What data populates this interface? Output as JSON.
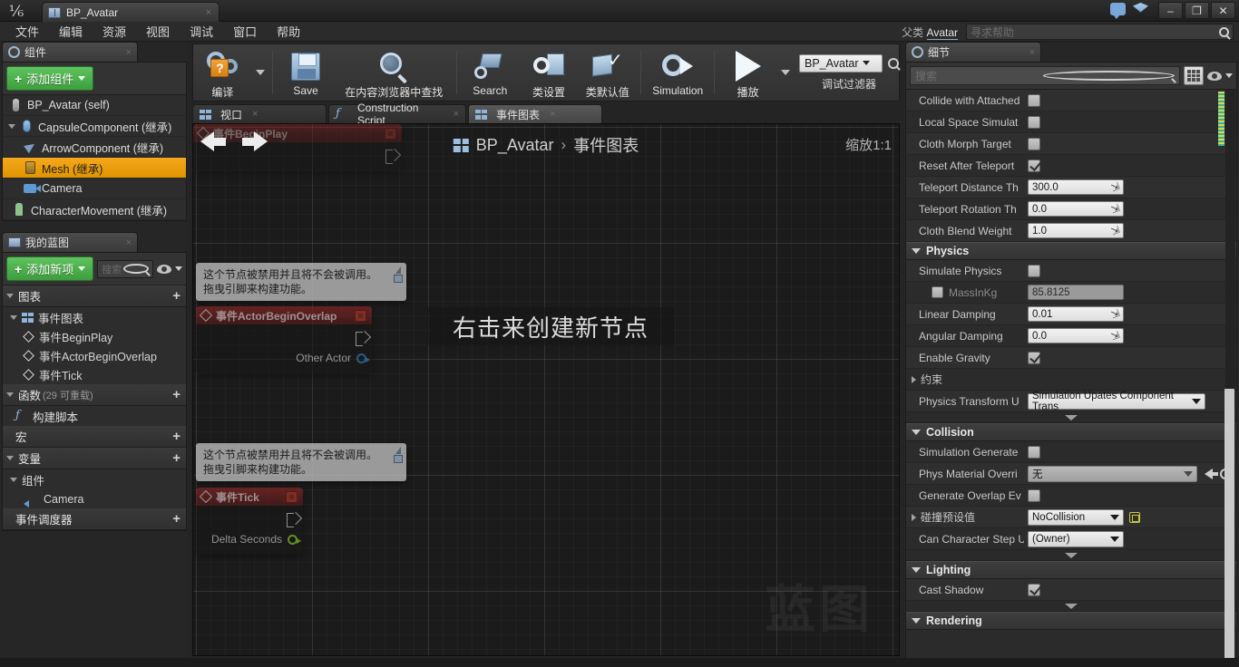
{
  "window": {
    "tab_title": "BP_Avatar",
    "tab_close": "×",
    "minimize": "–",
    "maximize": "❐",
    "close": "✕"
  },
  "menubar": {
    "items": [
      "文件",
      "编辑",
      "资源",
      "视图",
      "调试",
      "窗口",
      "帮助"
    ],
    "parent_class_label": "父类",
    "parent_class_value": "Avatar",
    "help_placeholder": "寻求帮助"
  },
  "toolbar": {
    "items": [
      {
        "label": "编译",
        "icon": "compile-icon"
      },
      {
        "label": "Save",
        "icon": "save-icon"
      },
      {
        "label": "在内容浏览器中查找",
        "icon": "find-in-content-browser-icon"
      },
      {
        "label": "Search",
        "icon": "search-icon"
      },
      {
        "label": "类设置",
        "icon": "class-settings-icon"
      },
      {
        "label": "类默认值",
        "icon": "class-defaults-icon"
      },
      {
        "label": "Simulation",
        "icon": "simulation-icon"
      },
      {
        "label": "播放",
        "icon": "play-icon"
      }
    ],
    "debug_filter_value": "BP_Avatar",
    "debug_filter_label": "调试过滤器"
  },
  "components_panel": {
    "tab_label": "组件",
    "tab_close": "×",
    "add_button": "添加组件",
    "items": [
      {
        "label": "BP_Avatar (self)",
        "indent": 0,
        "icon": "actor-icon",
        "selected": false,
        "twirl": ""
      },
      {
        "label": "CapsuleComponent (继承)",
        "indent": 0,
        "icon": "capsule-icon",
        "selected": false,
        "twirl": "open"
      },
      {
        "label": "ArrowComponent (继承)",
        "indent": 1,
        "icon": "arrow-icon",
        "selected": false,
        "twirl": ""
      },
      {
        "label": "Mesh (继承)",
        "indent": 1,
        "icon": "mesh-icon",
        "selected": true,
        "twirl": ""
      },
      {
        "label": "Camera",
        "indent": 1,
        "icon": "camera-icon",
        "selected": false,
        "twirl": ""
      },
      {
        "label": "CharacterMovement (继承)",
        "indent": 0,
        "icon": "character-movement-icon",
        "selected": false,
        "twirl": ""
      }
    ]
  },
  "myblueprint_panel": {
    "tab_label": "我的蓝图",
    "tab_close": "×",
    "add_button": "添加新项",
    "search_placeholder": "搜索",
    "sections": [
      {
        "label": "图表",
        "suffix": "",
        "plus": "+",
        "type": "header",
        "children": [
          {
            "label": "事件图表",
            "icon": "graph-icon",
            "level": "sub"
          },
          {
            "label": "事件BeginPlay",
            "icon": "event-icon",
            "level": "leaf"
          },
          {
            "label": "事件ActorBeginOverlap",
            "icon": "event-icon",
            "level": "leaf"
          },
          {
            "label": "事件Tick",
            "icon": "event-icon",
            "level": "leaf"
          }
        ]
      },
      {
        "label": "函数",
        "suffix": "(29 可重载)",
        "plus": "+",
        "type": "header",
        "children": [
          {
            "label": "构建脚本",
            "icon": "function-icon",
            "level": "sub"
          }
        ]
      },
      {
        "label": "宏",
        "suffix": "",
        "plus": "+",
        "type": "header",
        "children": []
      },
      {
        "label": "变量",
        "suffix": "",
        "plus": "+",
        "type": "header",
        "children": [
          {
            "label": "组件",
            "icon": "",
            "level": "sub"
          },
          {
            "label": "Camera",
            "icon": "camera-icon",
            "level": "leaf"
          }
        ]
      },
      {
        "label": "事件调度器",
        "suffix": "",
        "plus": "+",
        "type": "header",
        "children": []
      }
    ]
  },
  "center_tabs": [
    {
      "label": "视口",
      "icon": "viewport-icon",
      "active": false,
      "close": "×"
    },
    {
      "label": "Construction Script",
      "icon": "function-icon",
      "active": false,
      "close": "×"
    },
    {
      "label": "事件图表",
      "icon": "graph-icon",
      "active": true,
      "close": "×"
    }
  ],
  "graph": {
    "breadcrumb_root": "BP_Avatar",
    "breadcrumb_sep": "›",
    "breadcrumb_leaf": "事件图表",
    "zoom_label": "缩放1:1",
    "hint_text": "右击来创建新节点",
    "watermark": "蓝图",
    "nodes": [
      {
        "id": "beginplay",
        "title": "事件BeginPlay",
        "disabled": true,
        "pins": [
          {
            "label": "",
            "type": "exec"
          }
        ]
      },
      {
        "id": "actorbeginoverlap",
        "title": "事件ActorBeginOverlap",
        "disabled": true,
        "pins": [
          {
            "label": "",
            "type": "exec"
          },
          {
            "label": "Other Actor",
            "type": "object"
          }
        ]
      },
      {
        "id": "tick",
        "title": "事件Tick",
        "disabled": true,
        "pins": [
          {
            "label": "",
            "type": "exec"
          },
          {
            "label": "Delta Seconds",
            "type": "float"
          }
        ]
      }
    ],
    "tooltips": [
      {
        "line1": "这个节点被禁用并且将不会被调用。",
        "line2": "拖曳引脚来构建功能。"
      },
      {
        "line1": "这个节点被禁用并且将不会被调用。",
        "line2": "拖曳引脚来构建功能。"
      }
    ]
  },
  "details_panel": {
    "tab_label": "细节",
    "tab_close": "×",
    "search_placeholder": "搜索",
    "rows": [
      {
        "kind": "prop",
        "name": "Collide with Attached",
        "control": "checkbox",
        "checked": false
      },
      {
        "kind": "prop",
        "name": "Local Space Simulat",
        "control": "checkbox",
        "checked": false
      },
      {
        "kind": "prop",
        "name": "Cloth Morph Target",
        "control": "checkbox",
        "checked": false
      },
      {
        "kind": "prop",
        "name": "Reset After Teleport",
        "control": "checkbox",
        "checked": true
      },
      {
        "kind": "prop",
        "name": "Teleport Distance Th",
        "control": "number",
        "value": "300.0"
      },
      {
        "kind": "prop",
        "name": "Teleport Rotation Th",
        "control": "number",
        "value": "0.0"
      },
      {
        "kind": "prop",
        "name": "Cloth Blend Weight",
        "control": "number",
        "value": "1.0"
      },
      {
        "kind": "category",
        "name": "Physics"
      },
      {
        "kind": "prop",
        "name": "Simulate Physics",
        "control": "checkbox",
        "checked": false
      },
      {
        "kind": "prop",
        "name": "MassInKg",
        "control": "checkbox-number",
        "checked": false,
        "value": "85.8125",
        "dimmed": true
      },
      {
        "kind": "prop",
        "name": "Linear Damping",
        "control": "number",
        "value": "0.01"
      },
      {
        "kind": "prop",
        "name": "Angular Damping",
        "control": "number",
        "value": "0.0"
      },
      {
        "kind": "prop",
        "name": "Enable Gravity",
        "control": "checkbox",
        "checked": true
      },
      {
        "kind": "prop",
        "name": "约束",
        "control": "expandable"
      },
      {
        "kind": "prop",
        "name": "Physics Transform U",
        "control": "combo-wide",
        "value": "Simulation Upates Component Trans"
      },
      {
        "kind": "expander"
      },
      {
        "kind": "category",
        "name": "Collision"
      },
      {
        "kind": "prop",
        "name": "Simulation Generate",
        "control": "checkbox",
        "checked": false
      },
      {
        "kind": "prop",
        "name": "Phys Material Overri",
        "control": "asset-picker",
        "value": "无"
      },
      {
        "kind": "prop",
        "name": "Generate Overlap Ev",
        "control": "checkbox",
        "checked": false
      },
      {
        "kind": "prop",
        "name": "碰撞预设值",
        "control": "combo-revert",
        "value": "NoCollision",
        "expandable": true
      },
      {
        "kind": "prop",
        "name": "Can Character Step U",
        "control": "combo",
        "value": "(Owner)"
      },
      {
        "kind": "expander"
      },
      {
        "kind": "category",
        "name": "Lighting"
      },
      {
        "kind": "prop",
        "name": "Cast Shadow",
        "control": "checkbox",
        "checked": true
      },
      {
        "kind": "expander"
      },
      {
        "kind": "category",
        "name": "Rendering"
      }
    ]
  },
  "colors": {
    "accent_orange": "#f5a81c",
    "accent_green": "#4aaf4a",
    "node_red": "#9b2828",
    "exec_pin": "#d8d8d8",
    "object_pin": "#2d86c8",
    "float_pin": "#8cd62a"
  }
}
